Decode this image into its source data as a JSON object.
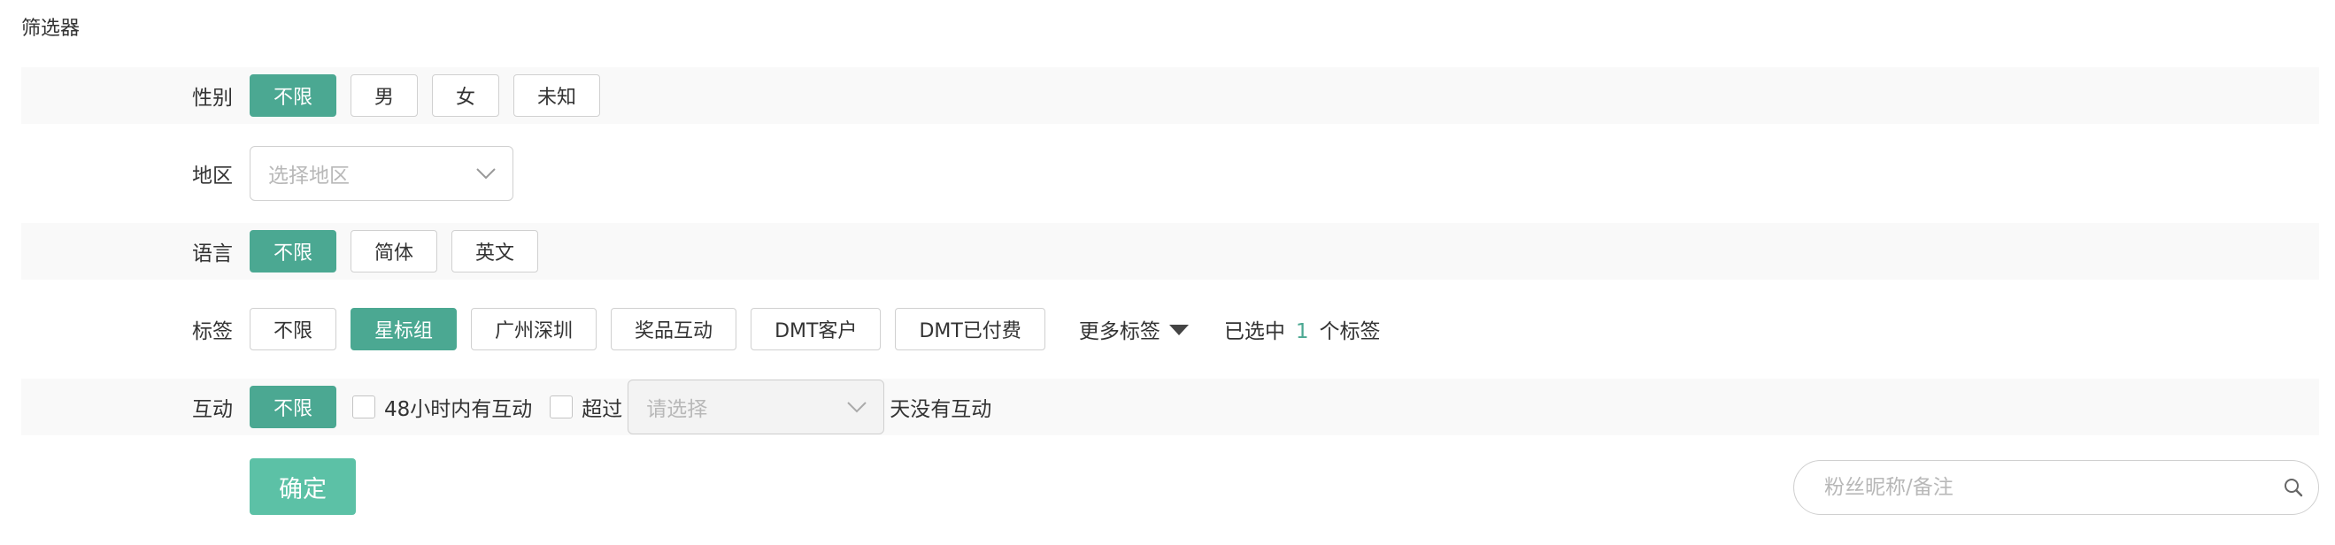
{
  "filter": {
    "title": "筛选器",
    "gender": {
      "label": "性别",
      "options": [
        "不限",
        "男",
        "女",
        "未知"
      ],
      "selected": "不限"
    },
    "region": {
      "label": "地区",
      "placeholder": "选择地区"
    },
    "language": {
      "label": "语言",
      "options": [
        "不限",
        "简体",
        "英文"
      ],
      "selected": "不限"
    },
    "tags": {
      "label": "标签",
      "options": [
        "不限",
        "星标组",
        "广州深圳",
        "奖品互动",
        "DMT客户",
        "DMT已付费"
      ],
      "selected": "星标组",
      "more_label": "更多标签",
      "selected_prefix": "已选中",
      "selected_count": "1",
      "selected_suffix": "个标签"
    },
    "interaction": {
      "label": "互动",
      "all_label": "不限",
      "check_48h_label": "48小时内有互动",
      "exceed_label": "超过",
      "days_placeholder": "请选择",
      "days_suffix": "天没有互动"
    }
  },
  "actions": {
    "confirm_label": "确定",
    "search_placeholder": "粉丝昵称/备注"
  },
  "colors": {
    "accent": "#4ba892",
    "confirm": "#5cc1a6",
    "row_shade": "#f9f9f9",
    "border": "#d0d0d0"
  }
}
